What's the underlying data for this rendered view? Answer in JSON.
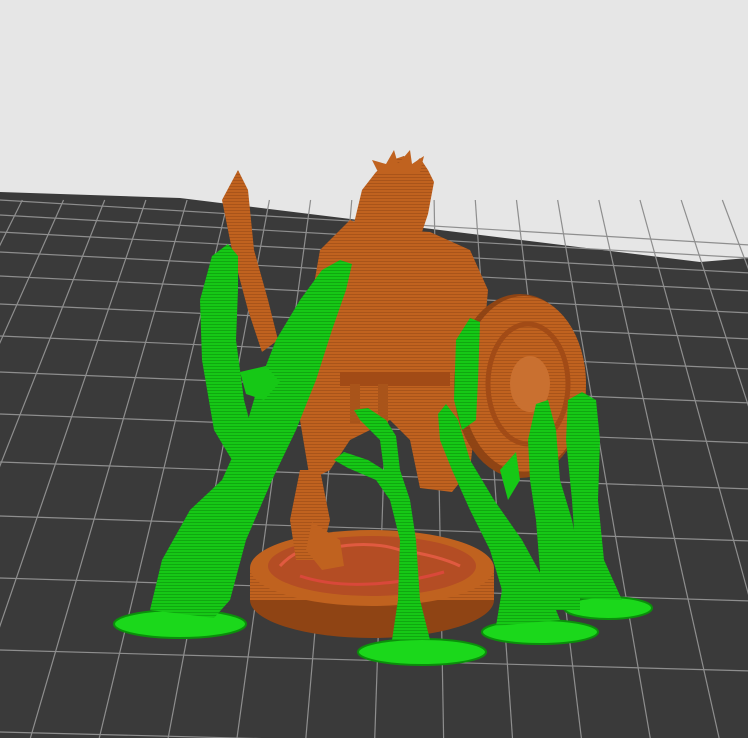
{
  "viewport": {
    "description_label": "",
    "colors": {
      "background": "#e6e6e6",
      "bed": "#3a3a3a",
      "bed_grid": "#9a9a9a",
      "model": "#c0621f",
      "model_shadow": "#8f4414",
      "model_highlight": "#d97a34",
      "support": "#14c814",
      "support_dark": "#0b8f0b",
      "support_base": "#1bd81b"
    },
    "objects": [
      {
        "kind": "model",
        "icon": "miniature-figure"
      },
      {
        "kind": "support",
        "icon": "tree-support",
        "count": 4
      }
    ]
  }
}
